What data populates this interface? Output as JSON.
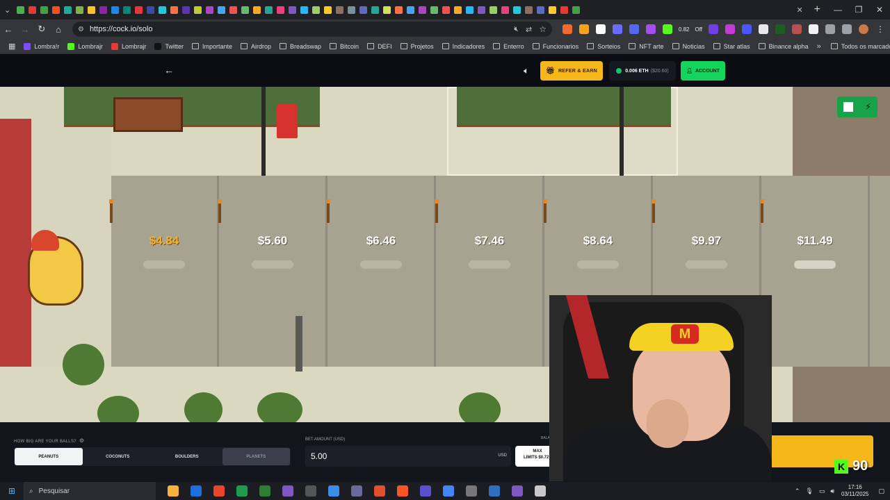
{
  "browser": {
    "url": "https://cock.io/solo",
    "tab_icon_colors": [
      "#4caf50",
      "#e53935",
      "#43a047",
      "#f4511e",
      "#26a69a",
      "#7cb342",
      "#fbc02d",
      "#8e24aa",
      "#1e88e5",
      "#00897b",
      "#e53935",
      "#3949ab",
      "#26c6da",
      "#ff7043",
      "#5e35b1",
      "#c0ca33",
      "#ab47bc",
      "#42a5f5",
      "#ef5350",
      "#66bb6a",
      "#ffa726",
      "#26a69a",
      "#ec407a",
      "#7e57c2",
      "#29b6f6",
      "#9ccc65",
      "#ffca28",
      "#8d6e63",
      "#78909c",
      "#5c6bc0",
      "#26a69a",
      "#d4e157",
      "#ff7043",
      "#42a5f5",
      "#ab47bc",
      "#66bb6a",
      "#ef5350",
      "#ffa726",
      "#29b6f6",
      "#7e57c2",
      "#9ccc65",
      "#ec407a",
      "#26c6da",
      "#8d6e63",
      "#5c6bc0",
      "#ffca28",
      "#e53935",
      "#43a047"
    ],
    "ext_zoom": "0.82",
    "ext_off": "Off",
    "bookmarks": [
      {
        "label": "Lombra!r",
        "color": "#7c4dff"
      },
      {
        "label": "Lombrajr",
        "color": "#53fc18"
      },
      {
        "label": "Lombrajr",
        "color": "#e53935"
      },
      {
        "label": "Twitter",
        "color": "#111111"
      },
      {
        "label": "Importante",
        "color": ""
      },
      {
        "label": "Airdrop",
        "color": ""
      },
      {
        "label": "Breadswap",
        "color": ""
      },
      {
        "label": "Bitcoin",
        "color": ""
      },
      {
        "label": "DEFI",
        "color": ""
      },
      {
        "label": "Projetos",
        "color": ""
      },
      {
        "label": "Indicadores",
        "color": ""
      },
      {
        "label": "Enterro",
        "color": ""
      },
      {
        "label": "Funcionarios",
        "color": ""
      },
      {
        "label": "Sorteios",
        "color": ""
      },
      {
        "label": "NFT arte",
        "color": ""
      },
      {
        "label": "Noticias",
        "color": ""
      },
      {
        "label": "Star atlas",
        "color": ""
      },
      {
        "label": "Binance alpha",
        "color": ""
      }
    ],
    "all_bookmarks": "Todos os marcadores",
    "more_bookmarks": "»"
  },
  "header": {
    "refer_label": "REFER & EARN",
    "eth_balance": "0.006 ETH",
    "usd_balance": "($20.60)",
    "account_label": "ACCOUNT"
  },
  "game": {
    "prices": [
      "$4.84",
      "$5.60",
      "$6.46",
      "$7.46",
      "$8.64",
      "$9.97",
      "$11.49"
    ],
    "active_price_index": 0
  },
  "controls": {
    "size_label": "HOW BIG ARE YOUR BALLS?",
    "size_tabs": [
      "PEANUTS",
      "COCONUTS",
      "BOULDERS",
      "PLANETS"
    ],
    "active_size": "PEANUTS",
    "disabled_size": "PLANETS",
    "bet_label": "BET AMOUNT (USD)",
    "bet_value": "5.00",
    "bet_unit": "USD",
    "max_label": "MAX",
    "limits_label": "LIMITS $0.72 -",
    "balance_label": "BALANCE"
  },
  "stream": {
    "viewer_count": "90",
    "cap_logo": "M"
  },
  "taskbar": {
    "search_placeholder": "Pesquisar",
    "time": "17:16",
    "date": "03/11/2025",
    "app_colors": [
      "#f3b33d",
      "#1e6fd9",
      "#e8452c",
      "#1e9b4f",
      "#2e7d32",
      "#7e57c2",
      "#555555",
      "#3a8ee6",
      "#6a6a9a",
      "#e04f2e",
      "#fb542b",
      "#5a4fcf",
      "#4285f4",
      "#777777",
      "#2f6fbf",
      "#7e57c2",
      "#c8c8c8"
    ]
  }
}
